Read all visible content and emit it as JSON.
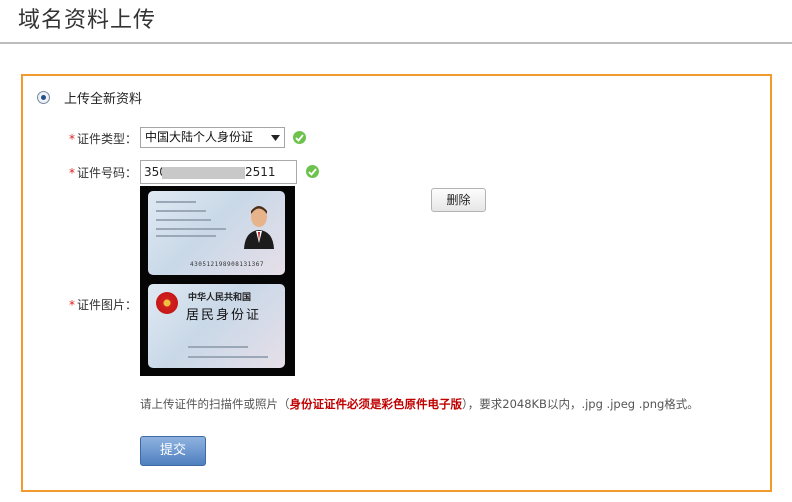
{
  "page": {
    "title": "域名资料上传"
  },
  "upload_option": {
    "label": "上传全新资料",
    "selected": true
  },
  "fields": {
    "id_type": {
      "label": "证件类型：",
      "value": "中国大陆个人身份证",
      "valid": true
    },
    "id_number": {
      "label": "证件号码：",
      "value_prefix": "350",
      "value_suffix": "2511",
      "valid": true
    },
    "id_image": {
      "label": "证件图片："
    }
  },
  "buttons": {
    "delete": "删除",
    "submit": "提交"
  },
  "id_card": {
    "number": "430512198908131367",
    "back_line1": "中华人民共和国",
    "back_line2": "居民身份证"
  },
  "hint": {
    "prefix": "请上传证件的扫描件或照片（",
    "emphasis": "身份证证件必须是彩色原件电子版",
    "suffix": "），要求2048KB以内，.jpg .jpeg .png格式。"
  },
  "colors": {
    "panel_border": "#f29a2e",
    "required_star": "#e02020",
    "valid_check": "#6cc24a",
    "hint_emphasis": "#c00000",
    "submit_button": "#4f7fbf"
  },
  "icons": [
    "radio-selected-icon",
    "check-icon",
    "chevron-down-icon",
    "portrait-icon",
    "emblem-icon"
  ]
}
